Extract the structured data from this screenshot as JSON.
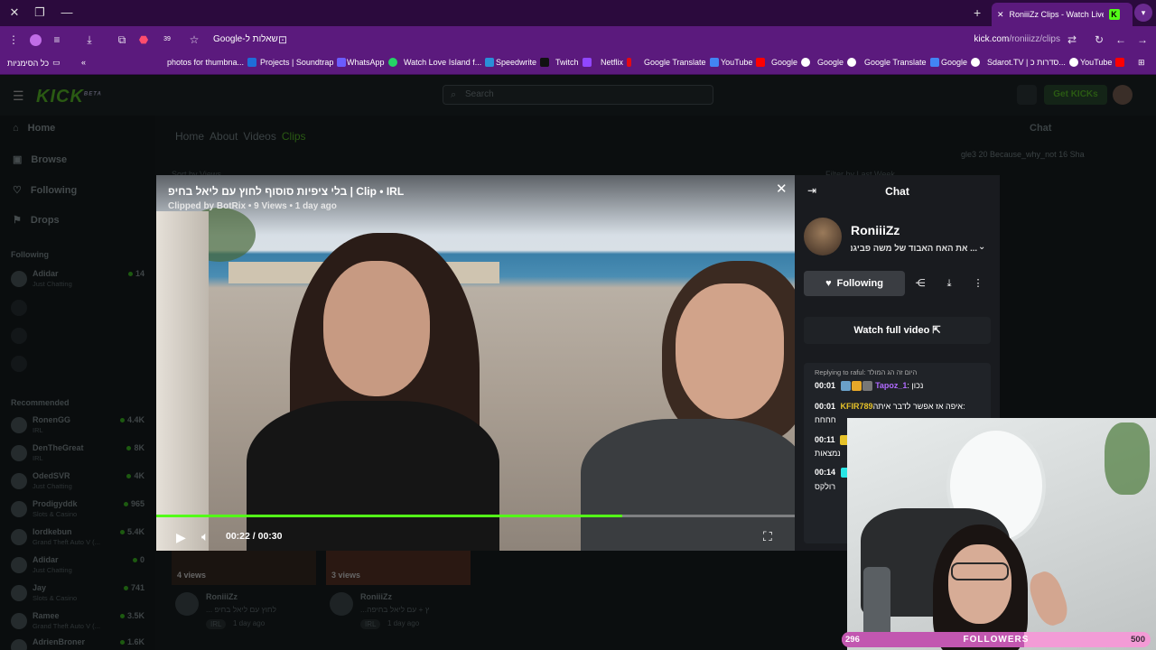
{
  "browser": {
    "tab_title": "RoniiiZz Clips - Watch Live on Kick",
    "new_tab": "+",
    "address": {
      "host": "kick.com",
      "path": "/roniiizz/clips"
    },
    "google_query": "שאלות ל-Google",
    "tab_badge": "K",
    "ext_badge": "39",
    "bookmarks": [
      {
        "label": "photos for thumbna...",
        "color": "#1f6dd8"
      },
      {
        "label": "Projects | Soundtrap",
        "color": "#6b5cff"
      },
      {
        "label": "WhatsApp",
        "color": "#25d366"
      },
      {
        "label": "Watch Love Island f...",
        "color": "#2a8fd8"
      },
      {
        "label": "Speedwrite",
        "color": "#111111"
      },
      {
        "label": "Twitch",
        "color": "#9146ff"
      },
      {
        "label": "Netflix",
        "color": "#e50914"
      },
      {
        "label": "Google Translate",
        "color": "#4285f4"
      },
      {
        "label": "YouTube",
        "color": "#ff0000"
      },
      {
        "label": "Google",
        "color": "#ffffff"
      },
      {
        "label": "Google",
        "color": "#ffffff"
      },
      {
        "label": "Google Translate",
        "color": "#4285f4"
      },
      {
        "label": "Google",
        "color": "#ffffff"
      },
      {
        "label": "Sdarot.TV | סדרות כ...",
        "color": "#ffffff"
      },
      {
        "label": "YouTube",
        "color": "#ff0000"
      }
    ],
    "all_bookmarks": "כל הסימניות"
  },
  "kick": {
    "logo": "KICK",
    "logo_beta": "BETA",
    "search_placeholder": "Search",
    "get_kicks": "Get KICKs",
    "nav": [
      {
        "label": "Home",
        "icon": "home-icon"
      },
      {
        "label": "Browse",
        "icon": "browse-icon"
      },
      {
        "label": "Following",
        "icon": "heart-icon"
      },
      {
        "label": "Drops",
        "icon": "gift-icon"
      }
    ],
    "following_label": "Following",
    "following": [
      {
        "name": "Adidar",
        "category": "Just Chatting",
        "viewers": "14"
      }
    ],
    "recommended_label": "Recommended",
    "recommended": [
      {
        "name": "RonenGG",
        "category": "IRL",
        "viewers": "4.4K"
      },
      {
        "name": "DenTheGreat",
        "category": "IRL",
        "viewers": "8K"
      },
      {
        "name": "OdedSVR",
        "category": "Just Chatting",
        "viewers": "4K"
      },
      {
        "name": "Prodigyddk",
        "category": "Slots & Casino",
        "viewers": "965"
      },
      {
        "name": "lordkebun",
        "category": "Grand Theft Auto V (...",
        "viewers": "5.4K"
      },
      {
        "name": "Adidar",
        "category": "Just Chatting",
        "viewers": "0"
      },
      {
        "name": "Jay",
        "category": "Slots & Casino",
        "viewers": "741"
      },
      {
        "name": "Ramee",
        "category": "Grand Theft Auto V (...",
        "viewers": "3.5K"
      },
      {
        "name": "AdrienBroner",
        "category": "",
        "viewers": "1.6K"
      }
    ],
    "tabs": [
      {
        "label": "Home",
        "active": false
      },
      {
        "label": "About",
        "active": false
      },
      {
        "label": "Videos",
        "active": false
      },
      {
        "label": "Clips",
        "active": true
      }
    ],
    "bg_chat_title": "Chat",
    "bg_chat_strip": "gle3 20   Because_why_not 16   Sha",
    "sort_text": "Sort by   Views",
    "filter_text": "Filter by   Last Week",
    "bg_cards": [
      {
        "views": "4 views",
        "channel": "RoniiiZz",
        "title": "... לחוץ עם ליאל בחיפ",
        "tag": "IRL",
        "ago": "1 day ago"
      },
      {
        "views": "3 views",
        "channel": "RoniiiZz",
        "title": "...ץ + עם ליאל בחיפה",
        "tag": "IRL",
        "ago": "1 day ago"
      }
    ]
  },
  "clip": {
    "title": "בלי ציפיות סוסוף לחוץ עם ליאל בחיפ | Clip • IRL",
    "meta": "Clipped by BotRix • 9 Views • 1 day ago",
    "time": "00:22 / 00:30",
    "progress": 0.73,
    "chat_title": "Chat",
    "streamer_name": "RoniiiZz",
    "streamer_sub": "... את האח האבוד של משה פביגנט",
    "follow_label": "Following",
    "watch_full": "Watch full video",
    "reply_line": "Replying to raful: היום זה הג המולד",
    "messages": [
      {
        "time": "00:01",
        "user": "Tapoz_1",
        "user_color": "#b06aff",
        "text": "נכון"
      },
      {
        "time": "00:01",
        "user": "KFIR789",
        "user_color": "#e6c229",
        "text": "איפה אז אפשר לדבר איתה:"
      },
      {
        "time": "",
        "user": "",
        "user_color": "#ffffff",
        "text": "חחחח"
      },
      {
        "time": "00:11",
        "user": "",
        "user_color": "#e6c229",
        "text": "נמצאות"
      },
      {
        "time": "00:14",
        "user": "",
        "user_color": "#29e6e6",
        "text": "רולקס"
      }
    ]
  },
  "overlay": {
    "followers_current": "296",
    "followers_label": "FOLLOWERS",
    "followers_goal": "500",
    "followers_fraction": 0.59
  }
}
